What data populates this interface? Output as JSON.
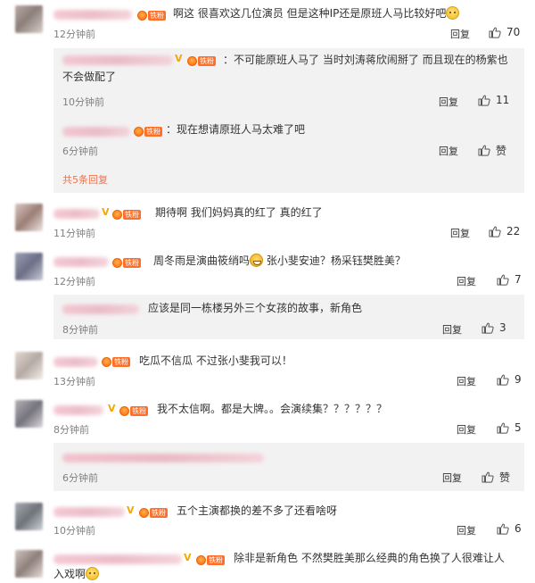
{
  "labels": {
    "reply": "回复",
    "fan_tag": "铁粉",
    "v_mark": "V",
    "like_text": "赞"
  },
  "comments": [
    {
      "text": "啊这 很喜欢这几位演员 但是这种IP还是原班人马比较好吧",
      "time": "12分钟前",
      "likes": "70"
    },
    {
      "text": "：不可能原班人马了 当时刘涛蒋欣闹掰了 而且现在的杨紫也不会做配了",
      "time": "10分钟前",
      "likes": "11"
    },
    {
      "text": "：现在想请原班人马太难了吧",
      "time": "6分钟前",
      "likes": "赞"
    },
    {
      "more": "共5条回复"
    },
    {
      "text": "期待啊 我们妈妈真的红了 真的红了",
      "time": "11分钟前",
      "likes": "22"
    },
    {
      "text": "周冬雨是演曲筱绡吗",
      "text2": "张小斐安迪？杨采钰樊胜美？",
      "time": "12分钟前",
      "likes": "7"
    },
    {
      "text": "应该是同一栋楼另外三个女孩的故事，新角色",
      "time": "8分钟前",
      "likes": "3"
    },
    {
      "text": "吃瓜不信瓜 不过张小斐我可以！",
      "time": "13分钟前",
      "likes": "9"
    },
    {
      "text": "我不太信啊。都是大牌。。会演续集？？？？？？",
      "time": "8分钟前",
      "likes": "5"
    },
    {
      "time": "6分钟前",
      "likes": "赞"
    },
    {
      "text": "五个主演都换的差不多了还看啥呀",
      "time": "10分钟前",
      "likes": "6"
    },
    {
      "text": "除非是新角色 不然樊胜美那么经典的角色换了人很难让人",
      "text2": "入戏啊"
    }
  ]
}
